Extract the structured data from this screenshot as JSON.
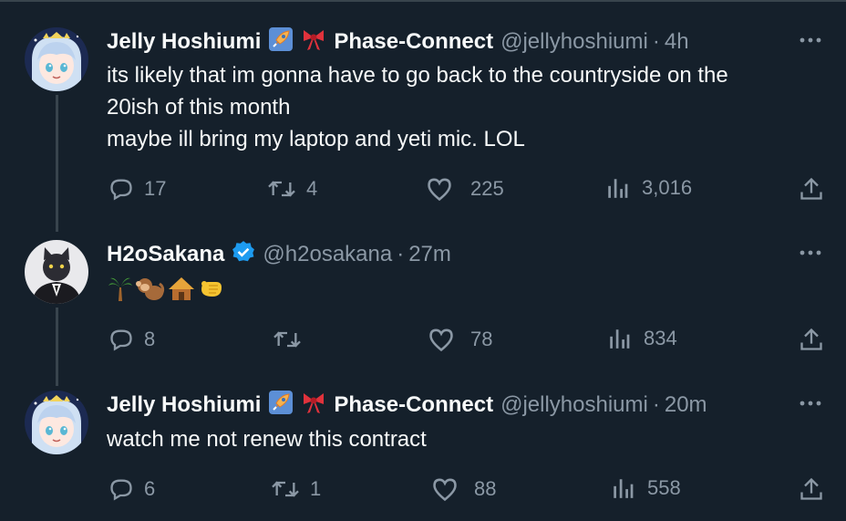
{
  "tweets": [
    {
      "name": "Jelly Hoshiumi",
      "org": "Phase-Connect",
      "handle": "@jellyhoshiumi",
      "separator": "·",
      "time": "4h",
      "lines": [
        "its likely that im gonna have to go back to the countryside on the",
        "20ish of this month",
        "maybe ill bring my laptop and yeti mic. LOL"
      ],
      "replies": "17",
      "reposts": "4",
      "likes": "225",
      "views": "3,016",
      "avatar": "anime-girl-avatar"
    },
    {
      "name": "H2oSakana",
      "handle": "@h2osakana",
      "separator": "·",
      "time": "27m",
      "emoji": [
        "🌴",
        "🐒",
        "🛖",
        "🫵"
      ],
      "replies": "8",
      "reposts": "",
      "likes": "78",
      "views": "834",
      "avatar": "cat-in-suit-avatar",
      "verified": true
    },
    {
      "name": "Jelly Hoshiumi",
      "org": "Phase-Connect",
      "handle": "@jellyhoshiumi",
      "separator": "·",
      "time": "20m",
      "lines": [
        "watch me not renew this contract"
      ],
      "replies": "6",
      "reposts": "1",
      "likes": "88",
      "views": "558",
      "avatar": "anime-girl-avatar"
    }
  ],
  "colors": {
    "background": "#15202b",
    "text": "#f7f9f9",
    "secondary": "#8b98a5",
    "verified": "#1d9bf0",
    "thread_line": "#38444d"
  }
}
